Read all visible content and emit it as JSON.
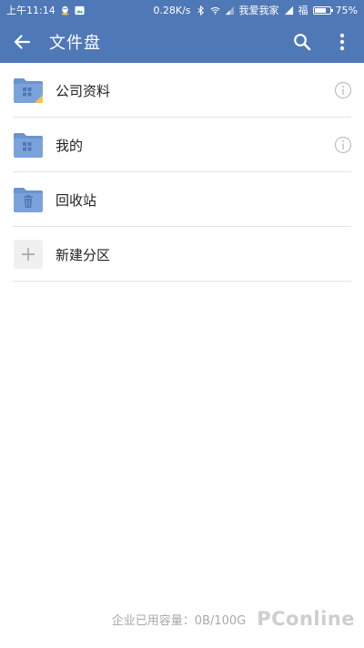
{
  "status_bar": {
    "time": "上午11:14",
    "speed": "0.28K/s",
    "carrier": "我爱我家",
    "carrier2": "福",
    "battery": "75%",
    "battery_level": 0.75
  },
  "app_bar": {
    "title": "文件盘"
  },
  "items": [
    {
      "label": "公司资料",
      "icon": "company-folder-icon"
    },
    {
      "label": "我的",
      "icon": "my-folder-icon"
    },
    {
      "label": "回收站",
      "icon": "trash-folder-icon"
    },
    {
      "label": "新建分区",
      "icon": "plus-icon"
    }
  ],
  "footer": {
    "usage_text": "企业已用容量：0B/100G",
    "watermark": "PConline"
  },
  "colors": {
    "primary": "#4f78b6",
    "folder": "#7ca2dc",
    "folder_tab": "#6b94d1",
    "badge_yellow": "#f2c44a"
  }
}
